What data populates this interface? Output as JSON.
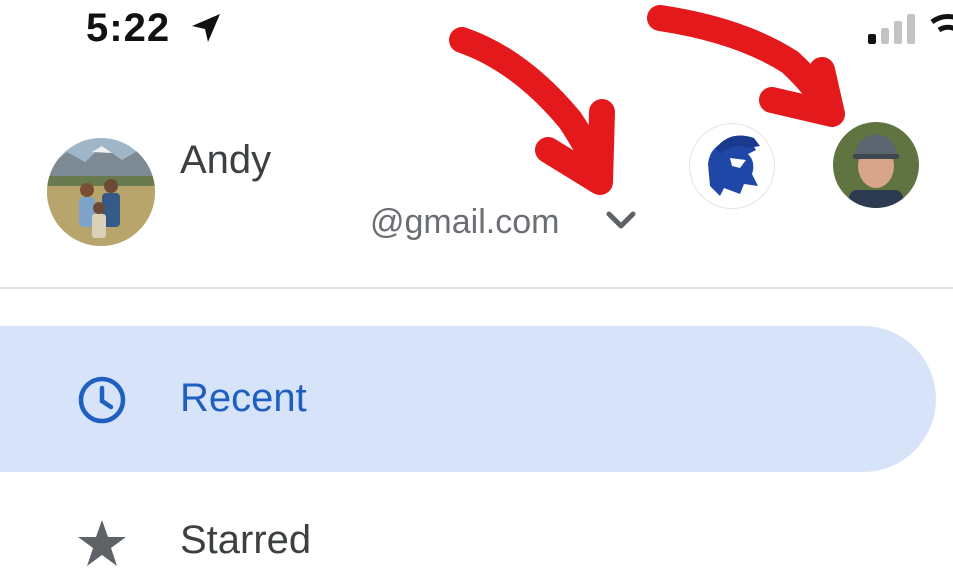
{
  "status_bar": {
    "time": "5:22",
    "location_icon": "location-arrow-icon",
    "signal_icon": "cellular-signal-icon",
    "wifi_icon": "wifi-icon"
  },
  "account": {
    "name": "Andy",
    "email": "@gmail.com",
    "switcher_icon": "chevron-down-icon"
  },
  "nav": {
    "items": [
      {
        "label": "Recent",
        "icon": "clock-icon",
        "selected": true
      },
      {
        "label": "Starred",
        "icon": "star-icon",
        "selected": false
      }
    ]
  },
  "colors": {
    "selected_bg": "#d6e3f8",
    "selected_text": "#1f5fbf",
    "annotation_arrow": "#e3191b"
  }
}
